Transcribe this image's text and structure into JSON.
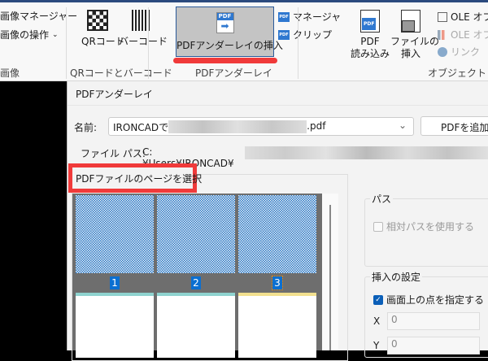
{
  "ribbon": {
    "image_group": {
      "manager": "画像マネージャー",
      "operations": "画像の操作",
      "label": "画像"
    },
    "qr_group": {
      "qr": "QRコード",
      "barcode": "バーコード",
      "label": "QRコードとバーコード"
    },
    "pdf_group": {
      "insert": "PDFアンダーレイの挿入",
      "manager": "マネージャ",
      "clip": "クリップ",
      "label": "PDFアンダーレイ"
    },
    "object_group": {
      "pdf_import_1": "PDF",
      "pdf_import_2": "読み込み",
      "file_insert_1": "ファイルの",
      "file_insert_2": "挿入",
      "ole1": "OLE オブ",
      "ole2": "OLE オブ",
      "link": "リンク",
      "label": "オブジェクト"
    }
  },
  "dialog": {
    "title": "PDFアンダーレイ",
    "name_label": "名前:",
    "name_value_prefix": "IRONCADで",
    "name_value_suffix": ".pdf",
    "add_pdf_button": "PDFを追加...",
    "file_path_label": "ファイル パス:",
    "file_path_value": "C:¥Users¥IRONCAD¥",
    "page_select_label": "PDFファイルのページを選択",
    "pages": [
      "1",
      "2",
      "3"
    ],
    "path_group": {
      "label": "パス",
      "relative_path": "相対パスを使用する"
    },
    "insert_group": {
      "label": "挿入の設定",
      "specify_on_screen": "画面上の点を指定する",
      "x_label": "X",
      "x_value": "0",
      "y_label": "Y",
      "y_value": "0"
    }
  },
  "colors": {
    "highlight": "#f03a3a",
    "accent": "#0b6fd1"
  }
}
